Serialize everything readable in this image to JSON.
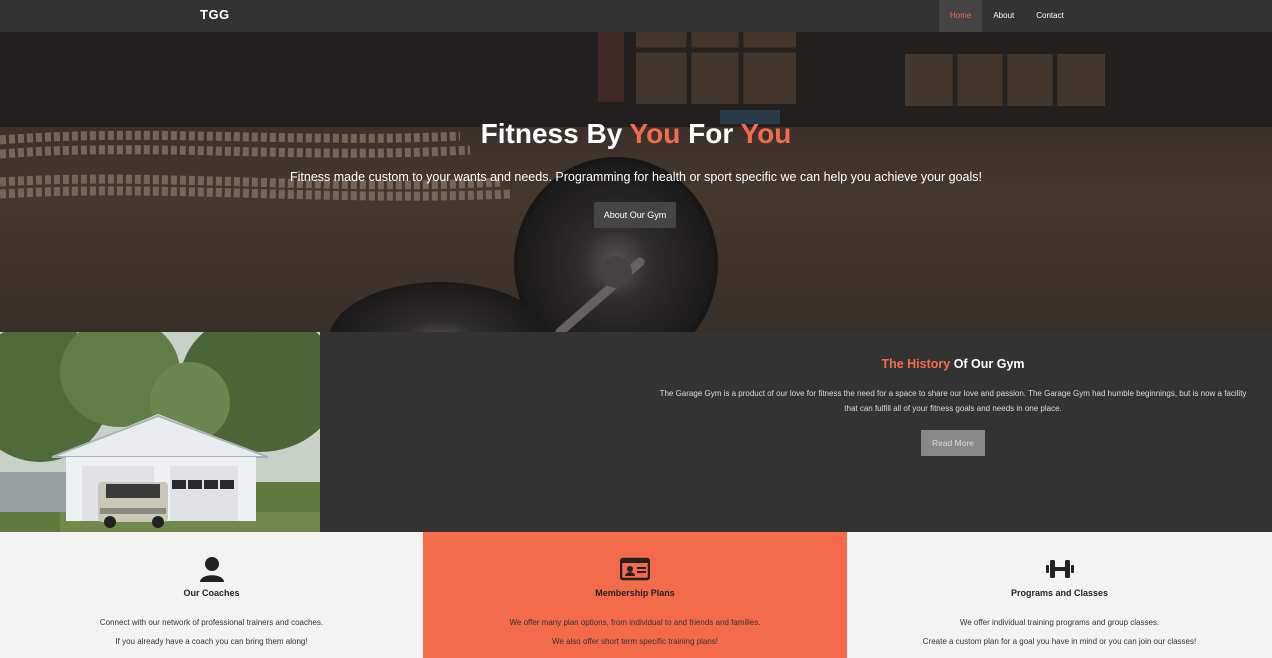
{
  "nav": {
    "brand": "TGG",
    "links": [
      "Home",
      "About",
      "Contact"
    ],
    "active": "Home"
  },
  "hero": {
    "title_part1": "Fitness By ",
    "title_accent1": "You",
    "title_part2": " For ",
    "title_accent2": "You",
    "subtitle": "Fitness made custom to your wants and needs. Programming for health or sport specific we can help you achieve your goals!",
    "button": "About Our Gym"
  },
  "history": {
    "title_accent": "The History",
    "title_rest": " Of Our Gym",
    "text": "The Garage Gym is a product of our love for fitness the need for a space to share our love and passion. The Garage Gym had humble beginnings, but is now a facility that can fulfill all of your fitness goals and needs in one place.",
    "button": "Read More"
  },
  "features": [
    {
      "icon": "user-icon",
      "title": "Our Coaches",
      "line1": "Connect with our network of professional trainers and coaches.",
      "line2": "If you already have a coach you can bring them along!"
    },
    {
      "icon": "id-card-icon",
      "title": "Membership Plans",
      "line1": "We offer many plan options, from individual to and friends and families.",
      "line2": "We also offer short term specific training plans!"
    },
    {
      "icon": "dumbbell-icon",
      "title": "Programs and Classes",
      "line1": "We offer individual training programs and group classes.",
      "line2": "Create a custom plan for a goal you have in mind or you can join our classes!"
    }
  ],
  "colors": {
    "accent": "#f46b4c",
    "dark": "#333333",
    "light": "#f3f3f3"
  }
}
